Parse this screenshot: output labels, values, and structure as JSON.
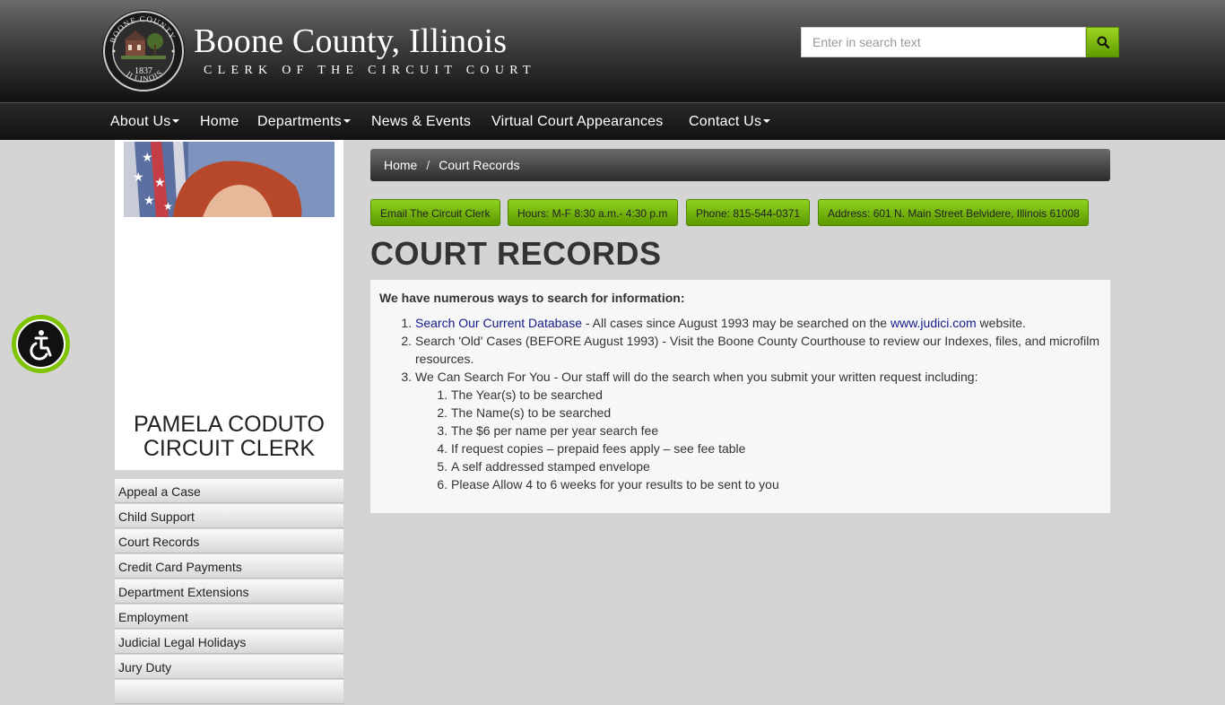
{
  "header": {
    "title": "Boone County, Illinois",
    "subtitle": "CLERK OF THE CIRCUIT COURT",
    "seal": {
      "top_text": "BOONE COUNTY",
      "bottom_text": "ILLINOIS",
      "year": "1837"
    },
    "search_placeholder": "Enter in search text"
  },
  "nav": {
    "items": [
      {
        "label": "About Us",
        "dropdown": true
      },
      {
        "label": "Home",
        "dropdown": false
      },
      {
        "label": "Departments",
        "dropdown": true
      },
      {
        "label": "News & Events",
        "dropdown": false
      },
      {
        "label": "Virtual Court Appearances",
        "dropdown": false
      },
      {
        "label": "Contact Us",
        "dropdown": true
      }
    ]
  },
  "profile": {
    "name": "PAMELA CODUTO",
    "role": "CIRCUIT CLERK"
  },
  "side_nav": {
    "items": [
      "Appeal a Case",
      "Child Support",
      "Court Records",
      "Credit Card Payments",
      "Department Extensions",
      "Employment",
      "Judicial Legal Holidays",
      "Jury Duty"
    ]
  },
  "breadcrumb": {
    "home": "Home",
    "separator": "/",
    "current": "Court Records"
  },
  "info_buttons": [
    "Email The Circuit Clerk",
    "Hours: M-F 8:30 a.m.- 4:30 p.m",
    "Phone: 815-544-0371",
    "Address: 601 N. Main Street Belvidere, Illinois 61008"
  ],
  "page_title": "COURT RECORDS",
  "content": {
    "intro": "We have numerous ways to search for information:",
    "item1": {
      "link": "Search Our Current Database",
      "text_before_link": " - All cases since August 1993 may be searched on the ",
      "link2": "www.judici.com",
      "text_after": " website."
    },
    "item2": "Search 'Old' Cases (BEFORE August 1993) - Visit the Boone County Courthouse to review our Indexes, files, and microfilm resources.",
    "item3": "We Can Search For You - Our staff will do the search when you submit your written request including:",
    "sub_items": [
      "The Year(s) to be searched",
      "The Name(s) to be searched",
      "The $6 per name per year search fee",
      "If request copies – prepaid fees apply – see fee table",
      "A self addressed stamped envelope",
      "Please Allow 4 to 6 weeks for your results to be sent to you"
    ]
  },
  "colors": {
    "accent_green": "#7ec400",
    "header_dark": "#111111",
    "page_bg": "#d4d4d4"
  }
}
